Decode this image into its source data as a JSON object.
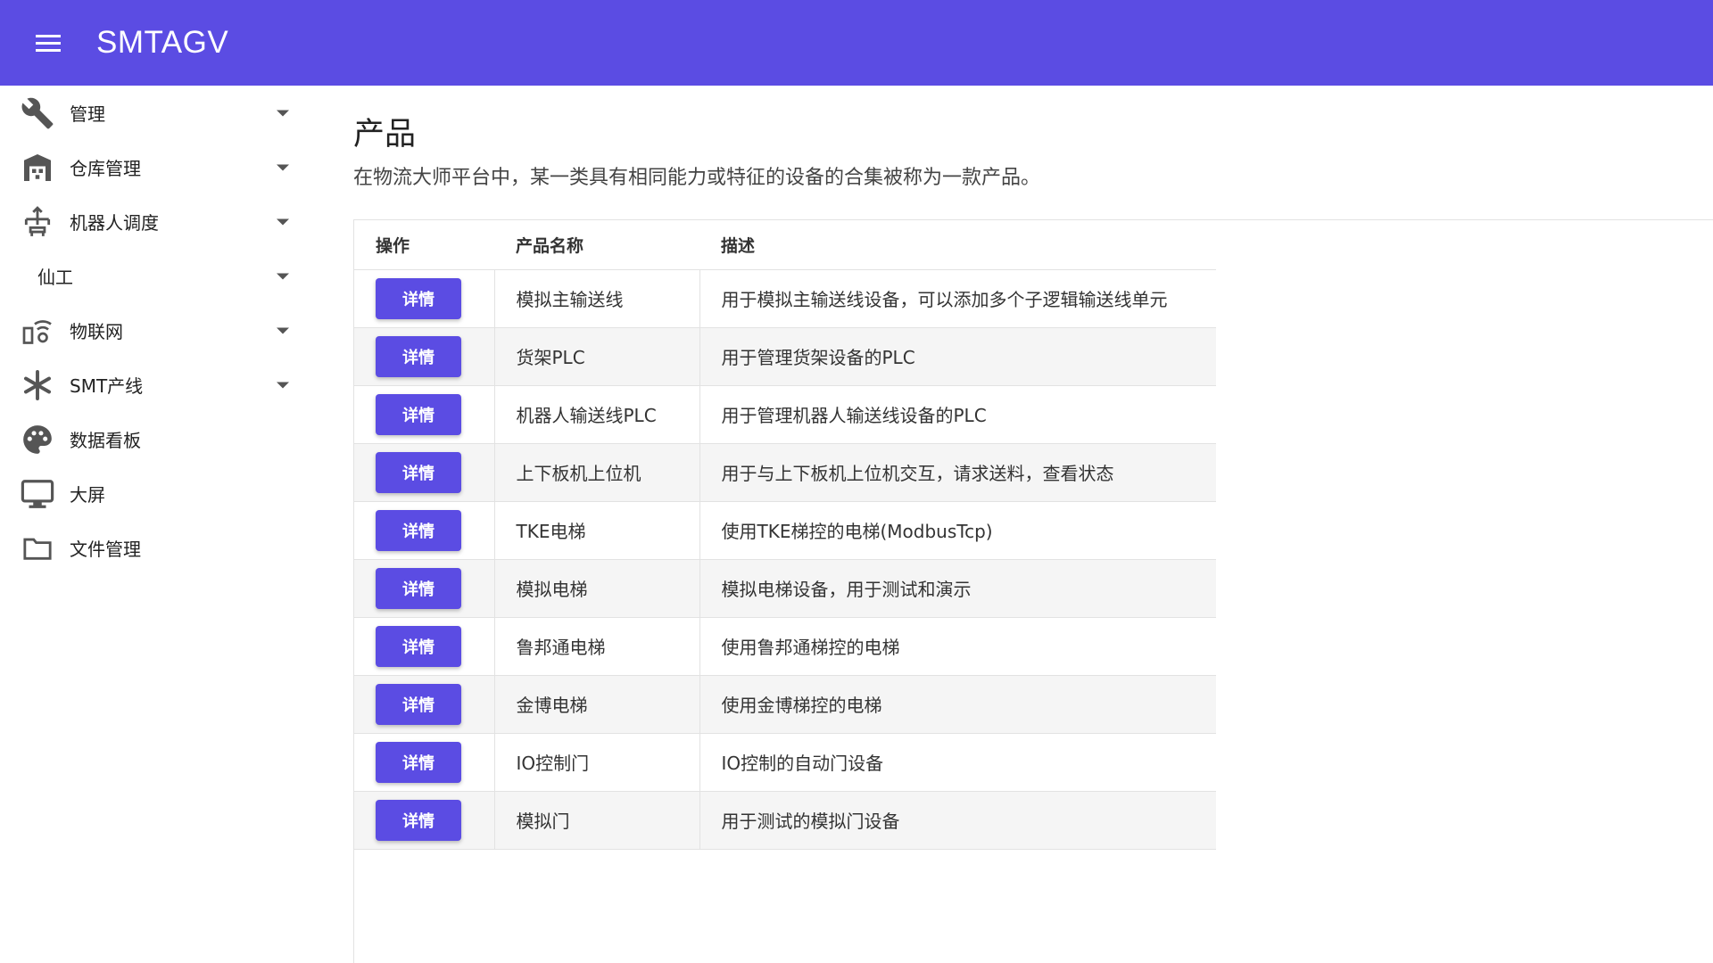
{
  "app": {
    "title": "SMTAGV"
  },
  "colors": {
    "accent": "#5b4ce3",
    "nav_icon": "#555555"
  },
  "sidebar": {
    "items": [
      {
        "label": "管理",
        "icon": "wrench-icon",
        "expandable": true
      },
      {
        "label": "仓库管理",
        "icon": "warehouse-icon",
        "expandable": true
      },
      {
        "label": "机器人调度",
        "icon": "robot-dispatch-icon",
        "expandable": true
      },
      {
        "label": "仙工",
        "icon": "",
        "expandable": true
      },
      {
        "label": "物联网",
        "icon": "iot-icon",
        "expandable": true
      },
      {
        "label": "SMT产线",
        "icon": "asterisk-icon",
        "expandable": true
      },
      {
        "label": "数据看板",
        "icon": "palette-icon",
        "expandable": false
      },
      {
        "label": "大屏",
        "icon": "monitor-icon",
        "expandable": false
      },
      {
        "label": "文件管理",
        "icon": "folder-icon",
        "expandable": false
      }
    ]
  },
  "main": {
    "title": "产品",
    "description": "在物流大师平台中，某一类具有相同能力或特征的设备的合集被称为一款产品。",
    "table": {
      "columns": [
        "操作",
        "产品名称",
        "描述"
      ],
      "button_label": "详情",
      "rows": [
        {
          "name": "模拟主输送线",
          "desc": "用于模拟主输送线设备，可以添加多个子逻辑输送线单元"
        },
        {
          "name": "货架PLC",
          "desc": "用于管理货架设备的PLC"
        },
        {
          "name": "机器人输送线PLC",
          "desc": "用于管理机器人输送线设备的PLC"
        },
        {
          "name": "上下板机上位机",
          "desc": "用于与上下板机上位机交互，请求送料，查看状态"
        },
        {
          "name": "TKE电梯",
          "desc": "使用TKE梯控的电梯(ModbusTcp)"
        },
        {
          "name": "模拟电梯",
          "desc": "模拟电梯设备，用于测试和演示"
        },
        {
          "name": "鲁邦通电梯",
          "desc": "使用鲁邦通梯控的电梯"
        },
        {
          "name": "金博电梯",
          "desc": "使用金博梯控的电梯"
        },
        {
          "name": "IO控制门",
          "desc": "IO控制的自动门设备"
        },
        {
          "name": "模拟门",
          "desc": "用于测试的模拟门设备"
        }
      ]
    }
  }
}
